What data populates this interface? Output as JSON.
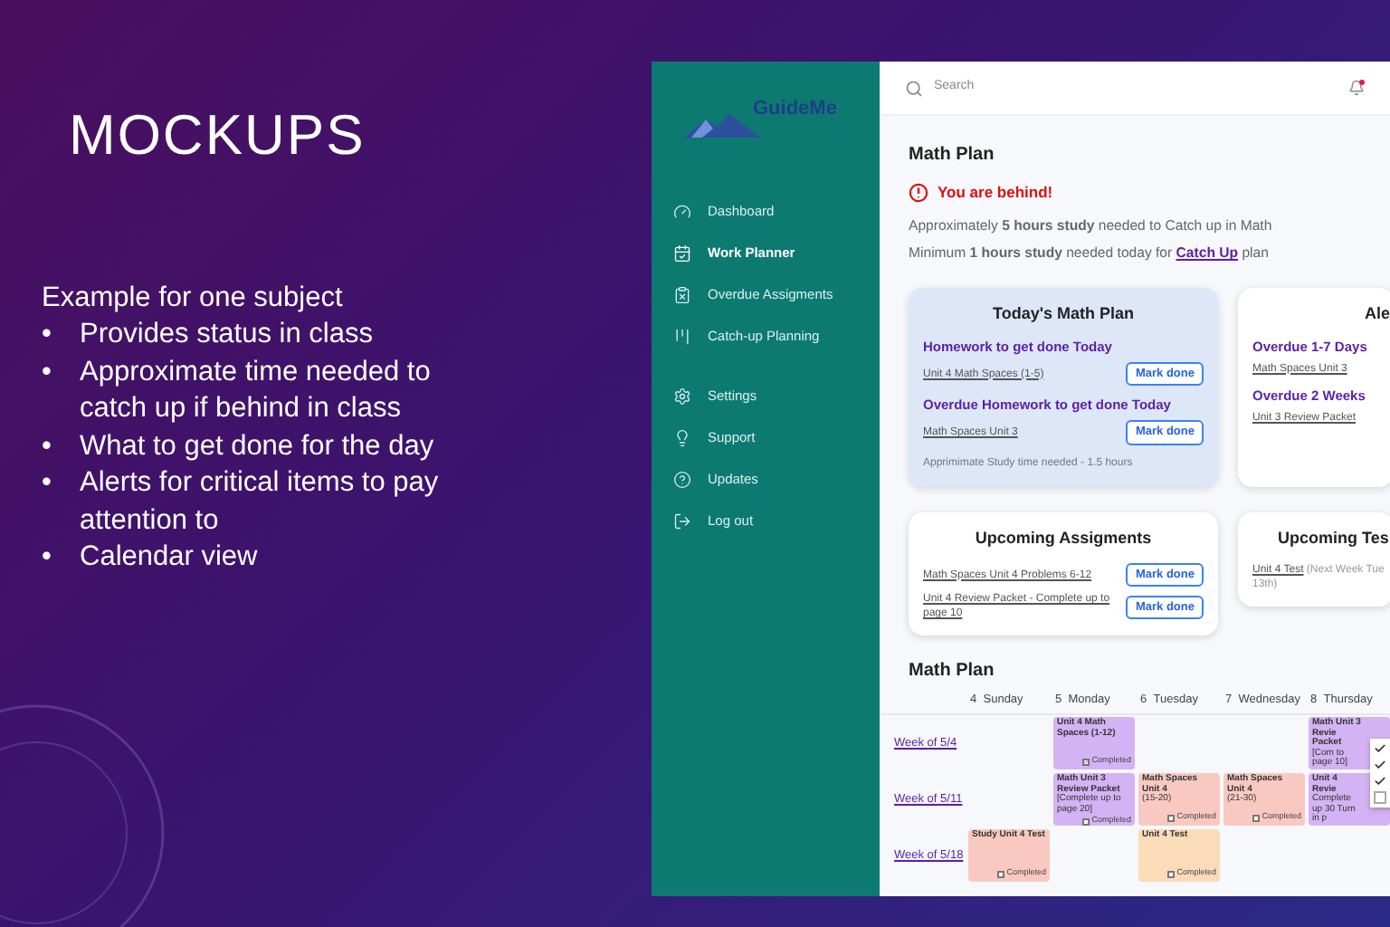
{
  "slide": {
    "title": "MOCKUPS",
    "intro": "Example for one subject",
    "bullets": [
      {
        "mark": "•",
        "text": "Provides status in class"
      },
      {
        "mark": "•",
        "text": "Approximate time needed to catch up if behind in class"
      },
      {
        "mark": "•",
        "text": "What to get done for the day"
      },
      {
        "mark": "•",
        "text": "Alerts for critical items to pay attention to"
      },
      {
        "mark": "•",
        "text": "Calendar view"
      }
    ]
  },
  "app": {
    "logo": "GuideMe",
    "nav_groups": [
      [
        {
          "label": "Dashboard",
          "selected": false
        },
        {
          "label": "Work Planner",
          "selected": true
        },
        {
          "label": "Overdue Assigments",
          "selected": false
        },
        {
          "label": "Catch-up Planning",
          "selected": false
        }
      ],
      [
        {
          "label": "Settings",
          "selected": false
        },
        {
          "label": "Support",
          "selected": false
        },
        {
          "label": "Updates",
          "selected": false
        },
        {
          "label": "Log out",
          "selected": false
        }
      ]
    ],
    "search": {
      "placeholder": "Search"
    },
    "notifications": {
      "unread": true
    },
    "heading": "Math Plan",
    "alert": "You are behind!",
    "status_lines": [
      {
        "text": "Approximately **5 hours study** needed to Catch up in Math"
      },
      {
        "text": "Minimum **1 hours study** needed today for",
        "link": "Catch Up",
        "after": "plan"
      }
    ],
    "cards": [
      {
        "title": "Today's Math Plan",
        "highlight": true,
        "sections": [
          {
            "heading": "Homework to get done Today",
            "items": [
              {
                "label": "Unit 4 Math Spaces (1-5)",
                "button": "Mark done"
              }
            ]
          },
          {
            "heading": "Overdue Homework to get done Today",
            "items": [
              {
                "label": "Math Spaces Unit 3",
                "button": "Mark done"
              }
            ]
          }
        ],
        "footer": "Apprimimate Study time needed - 1.5 hours"
      },
      {
        "title": "Ale",
        "highlight": false,
        "sections": [
          {
            "heading": "Overdue 1-7 Days",
            "items": [
              {
                "label": "Math Spaces Unit 3"
              }
            ]
          },
          {
            "heading": "Overdue 2 Weeks",
            "items": [
              {
                "label": "Unit 3 Review Packet"
              }
            ]
          }
        ]
      },
      {
        "title": "Upcoming Assigments",
        "highlight": false,
        "sections": [
          {
            "items": [
              {
                "label": "Math Spaces Unit 4 Problems 6-12",
                "button": "Mark done"
              },
              {
                "label": "Unit 4 Review Packet - Complete up to page 10",
                "button": "Mark done"
              }
            ]
          }
        ]
      },
      {
        "title": "Upcoming Tes",
        "highlight": false,
        "sections": [
          {
            "items": [
              {
                "label": "Unit 4 Test",
                "note": "(Next Week Tue 13th)"
              }
            ]
          }
        ]
      }
    ],
    "calendar": {
      "title": "Math Plan",
      "days": [
        {
          "num": "4",
          "name": "Sunday"
        },
        {
          "num": "5",
          "name": "Monday"
        },
        {
          "num": "6",
          "name": "Tuesday"
        },
        {
          "num": "7",
          "name": "Wednesday"
        },
        {
          "num": "8",
          "name": "Thursday"
        }
      ],
      "weeks": [
        {
          "label": "Week of 5/4",
          "events": [
            {
              "kind": "empty"
            },
            {
              "kind": "homework",
              "title": "Unit 4 Math Spaces (1-12)",
              "completed_label": "Completed",
              "checked": true
            },
            {
              "kind": "empty"
            },
            {
              "kind": "empty"
            },
            {
              "kind": "homework",
              "title": "Math Unit 3 Revie Packet",
              "detail": "[Com to page 10]"
            }
          ]
        },
        {
          "label": "Week of 5/11",
          "events": [
            {
              "kind": "empty"
            },
            {
              "kind": "homework",
              "title": "Math Unit 3 Review Packet",
              "detail": "[Complete up to page 20]",
              "completed_label": "Completed",
              "checked": false
            },
            {
              "kind": "study",
              "title": "Math Spaces Unit 4",
              "detail": "(15-20)",
              "completed_label": "Completed",
              "checked": false
            },
            {
              "kind": "study",
              "title": "Math Spaces Unit 4",
              "detail": "(21-30)",
              "completed_label": "Completed",
              "checked": false
            },
            {
              "kind": "homework",
              "title": "Unit 4 Revie",
              "detail": "Complete up 30 Turn in p"
            }
          ]
        },
        {
          "label": "Week of 5/18",
          "events": [
            {
              "kind": "study",
              "title": "Study Unit 4 Test",
              "completed_label": "Completed",
              "checked": false
            },
            {
              "kind": "empty"
            },
            {
              "kind": "test",
              "title": "Unit 4 Test",
              "completed_label": "Completed",
              "checked": false
            },
            {
              "kind": "empty"
            },
            {
              "kind": "empty"
            }
          ]
        }
      ],
      "popup": [
        {
          "checked": true
        },
        {
          "checked": true
        },
        {
          "checked": true
        },
        {
          "checked": false
        }
      ]
    }
  }
}
